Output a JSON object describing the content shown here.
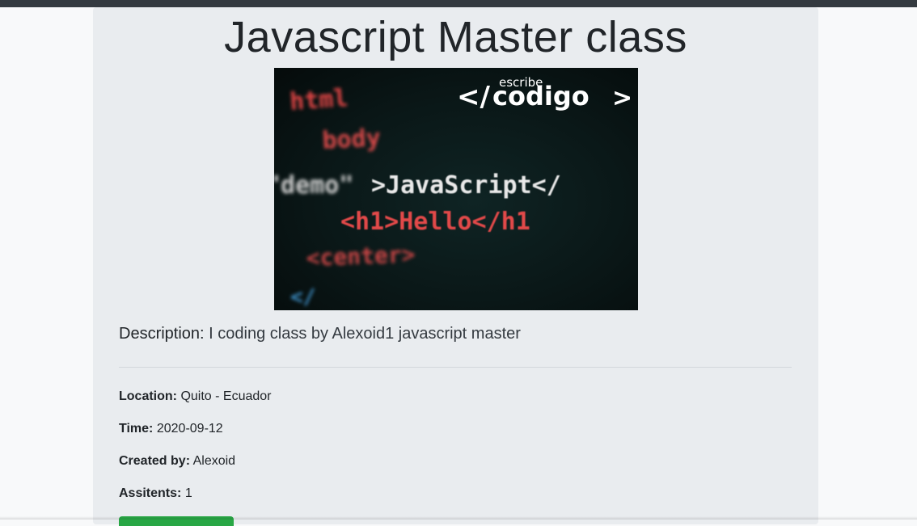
{
  "event": {
    "title": "Javascript Master class",
    "image": {
      "alt": "escribe codigo JavaScript banner",
      "logo_small": "escribe",
      "logo_big": "codigo",
      "logo_prefix": "</",
      "logo_suffix": ">",
      "code_lines": [
        "html",
        "body",
        "\"demo\"",
        ">JavaScript</",
        "<h1>Hello</h1",
        "<center>",
        "</"
      ]
    },
    "description_label": "Description:",
    "description": "I coding class by Alexoid1 javascript master",
    "fields": [
      {
        "label": "Location:",
        "value": "Quito - Ecuador"
      },
      {
        "label": "Time:",
        "value": "2020-09-12"
      },
      {
        "label": "Created by:",
        "value": "Alexoid"
      },
      {
        "label": "Assitents:",
        "value": "1"
      }
    ]
  },
  "colors": {
    "topbar": "#343a40",
    "card": "#e9ecef",
    "page": "#f8f9fa",
    "button": "#28a745"
  }
}
